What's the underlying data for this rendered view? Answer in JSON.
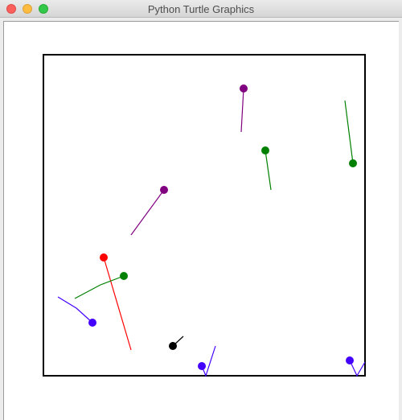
{
  "window": {
    "title": "Python Turtle Graphics"
  },
  "colors": {
    "arena_border": "#000000",
    "canvas_background": "#ffffff"
  },
  "balls": [
    {
      "name": "ball-purple-top",
      "color": "#800080"
    },
    {
      "name": "ball-green-upper",
      "color": "#008000"
    },
    {
      "name": "ball-green-right",
      "color": "#008000"
    },
    {
      "name": "ball-purple-mid",
      "color": "#800080"
    },
    {
      "name": "ball-red",
      "color": "#ff0000"
    },
    {
      "name": "ball-green-left",
      "color": "#008000"
    },
    {
      "name": "ball-blue-left",
      "color": "#4400ff"
    },
    {
      "name": "ball-black",
      "color": "#000000"
    },
    {
      "name": "ball-blue-bottom",
      "color": "#4400ff"
    },
    {
      "name": "ball-blue-right",
      "color": "#4400ff"
    }
  ]
}
